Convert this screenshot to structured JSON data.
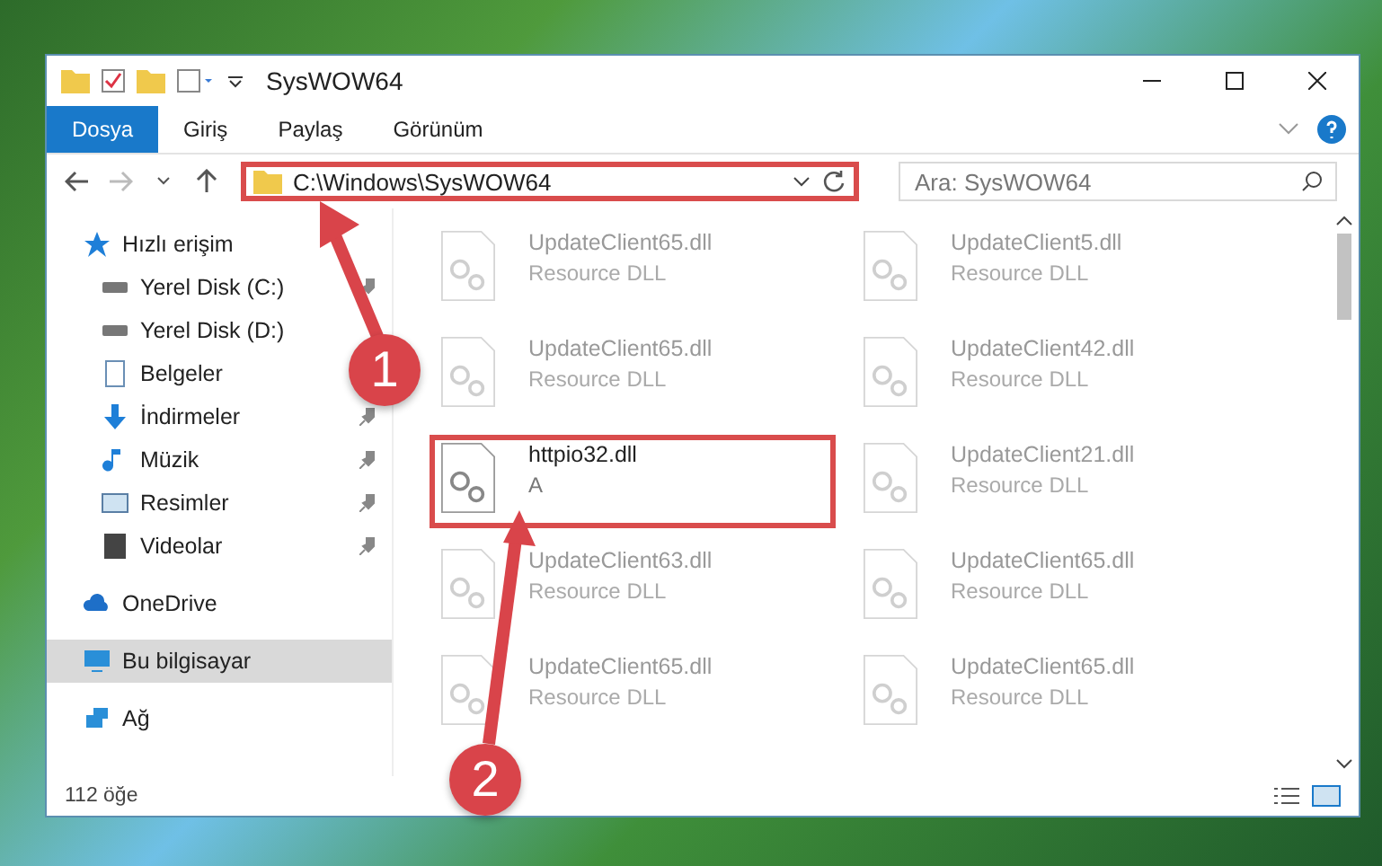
{
  "window": {
    "title": "SysWOW64"
  },
  "ribbon_tabs": [
    {
      "label": "Dosya",
      "selected": true
    },
    {
      "label": "Giriş",
      "selected": false
    },
    {
      "label": "Paylaş",
      "selected": false
    },
    {
      "label": "Görünüm",
      "selected": false
    }
  ],
  "address": {
    "path": "C:\\Windows\\SysWOW64",
    "highlighted": true
  },
  "search": {
    "placeholder": "Ara: SysWOW64"
  },
  "sidebar": {
    "items": [
      {
        "label": "Hızlı erişim",
        "kind": "star",
        "selected": false,
        "children": [
          {
            "label": "Yerel Disk (C:)",
            "kind": "drive",
            "pinned": true,
            "selected": false
          },
          {
            "label": "Yerel Disk (D:)",
            "kind": "drive",
            "selected": false
          },
          {
            "label": "Belgeler",
            "kind": "document",
            "selected": false
          },
          {
            "label": "İndirmeler",
            "kind": "download",
            "pinned": true,
            "selected": false
          },
          {
            "label": "Müzik",
            "kind": "music",
            "pinned": true,
            "selected": false
          },
          {
            "label": "Resimler",
            "kind": "picture",
            "pinned": true,
            "selected": false
          },
          {
            "label": "Videolar",
            "kind": "video",
            "pinned": true,
            "selected": false
          }
        ]
      },
      {
        "label": "OneDrive",
        "kind": "cloud",
        "selected": false
      },
      {
        "label": "Bu bilgisayar",
        "kind": "computer",
        "selected": true
      },
      {
        "label": "Ağ",
        "kind": "network",
        "selected": false
      }
    ]
  },
  "files": [
    {
      "name": "UpdateClient65.dll",
      "type": "Resource DLL",
      "highlighted": false
    },
    {
      "name": "UpdateClient5.dll",
      "type": "Resource DLL",
      "highlighted": false
    },
    {
      "name": "UpdateClient65.dll",
      "type": "Resource DLL",
      "highlighted": false
    },
    {
      "name": "UpdateClient42.dll",
      "type": "Resource DLL",
      "highlighted": false
    },
    {
      "name": "httpio32.dll",
      "type": "A",
      "highlighted": true
    },
    {
      "name": "UpdateClient21.dll",
      "type": "Resource DLL",
      "highlighted": false
    },
    {
      "name": "UpdateClient63.dll",
      "type": "Resource DLL",
      "highlighted": false
    },
    {
      "name": "UpdateClient65.dll",
      "type": "Resource DLL",
      "highlighted": false
    },
    {
      "name": "UpdateClient65.dll",
      "type": "Resource DLL",
      "highlighted": false
    },
    {
      "name": "UpdateClient65.dll",
      "type": "Resource DLL",
      "highlighted": false
    }
  ],
  "status_bar": {
    "count": "112 öğe"
  },
  "annotations": [
    {
      "number": "1"
    },
    {
      "number": "2"
    }
  ]
}
